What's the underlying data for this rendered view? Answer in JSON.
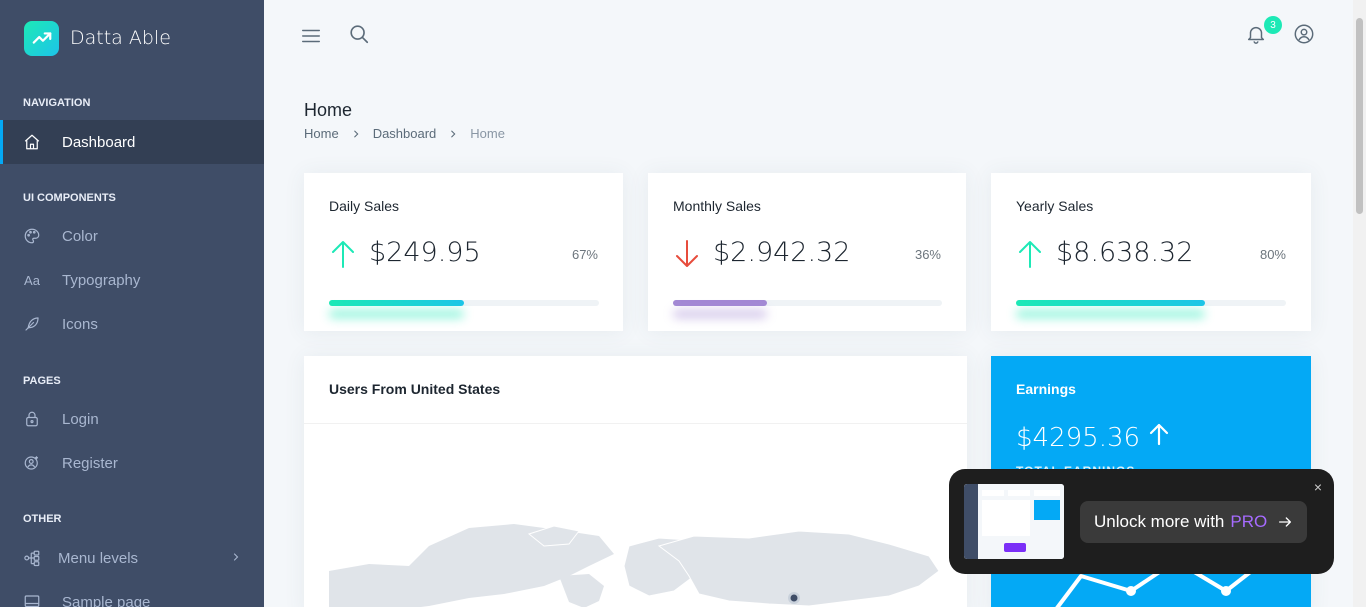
{
  "brand": {
    "name": "Datta Able"
  },
  "sidebar": {
    "sections": [
      {
        "caption": "NAVIGATION"
      },
      {
        "caption": "UI COMPONENTS"
      },
      {
        "caption": "PAGES"
      },
      {
        "caption": "OTHER"
      }
    ],
    "items": [
      {
        "label": "Dashboard",
        "icon": "home-icon",
        "active": true
      },
      {
        "label": "Color",
        "icon": "palette-icon"
      },
      {
        "label": "Typography",
        "icon": "typography-icon"
      },
      {
        "label": "Icons",
        "icon": "feather-icon"
      },
      {
        "label": "Login",
        "icon": "lock-icon"
      },
      {
        "label": "Register",
        "icon": "user-plus-icon"
      },
      {
        "label": "Menu levels",
        "icon": "menu-levels-icon"
      },
      {
        "label": "Sample page",
        "icon": "sample-page-icon"
      }
    ]
  },
  "header": {
    "notification_count": "3"
  },
  "page": {
    "title": "Home",
    "breadcrumb": [
      "Home",
      "Dashboard",
      "Home"
    ]
  },
  "sales_cards": [
    {
      "title": "Daily Sales",
      "amount": "$249.95",
      "percent": "67%",
      "trend": "up",
      "progress": 0.5,
      "color": "#1de9b6"
    },
    {
      "title": "Monthly Sales",
      "amount": "$2.942.32",
      "percent": "36%",
      "trend": "down",
      "progress": 0.35,
      "color": "#a389d4"
    },
    {
      "title": "Yearly Sales",
      "amount": "$8.638.32",
      "percent": "80%",
      "trend": "up",
      "progress": 0.7,
      "color": "#1de9b6"
    }
  ],
  "users_card": {
    "title": "Users From United States"
  },
  "earnings_card": {
    "title": "Earnings",
    "amount": "$4295.36",
    "label": "TOTAL EARNINGS",
    "color": "#04a9f5"
  },
  "promo": {
    "text": "Unlock more with",
    "highlight": "PRO",
    "close": "×"
  }
}
